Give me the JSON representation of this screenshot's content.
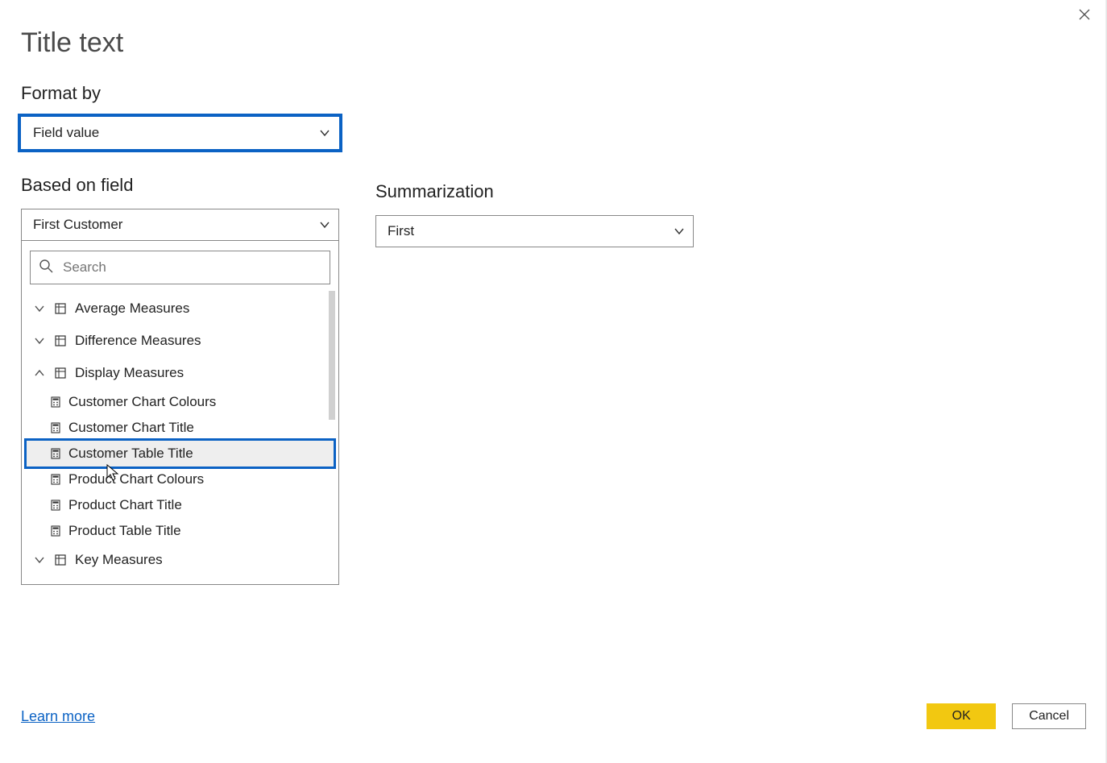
{
  "dialog": {
    "title": "Title text"
  },
  "format_by": {
    "label": "Format by",
    "value": "Field value"
  },
  "based_on_field": {
    "label": "Based on field",
    "value": "First Customer",
    "search_placeholder": "Search"
  },
  "summarization": {
    "label": "Summarization",
    "value": "First"
  },
  "tree": {
    "groups": [
      {
        "name": "Average Measures",
        "expanded": false
      },
      {
        "name": "Difference Measures",
        "expanded": false
      },
      {
        "name": "Display Measures",
        "expanded": true,
        "children": [
          "Customer Chart Colours",
          "Customer Chart Title",
          "Customer Table Title",
          "Product Chart Colours",
          "Product Chart Title",
          "Product Table Title"
        ],
        "selected": "Customer Table Title"
      },
      {
        "name": "Key Measures",
        "expanded": false
      }
    ]
  },
  "footer": {
    "learn_more": "Learn more",
    "ok": "OK",
    "cancel": "Cancel"
  }
}
